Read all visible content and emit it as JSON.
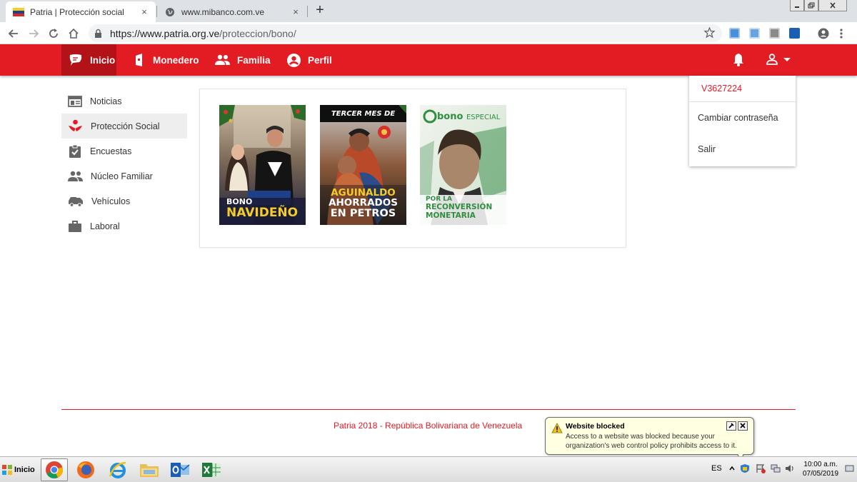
{
  "browser": {
    "tabs": [
      {
        "title": "Patria | Protección social",
        "active": true
      },
      {
        "title": "www.mibanco.com.ve",
        "active": false
      }
    ],
    "new_tab_label": "+",
    "close_glyph": "×",
    "url_host": "https://www.patria.org.ve",
    "url_path": "/proteccion/bono/"
  },
  "appbar": {
    "nav": [
      {
        "label": "Inicio",
        "icon": "chat-bubble-icon",
        "active": true
      },
      {
        "label": "Monedero",
        "icon": "wallet-icon",
        "active": false
      },
      {
        "label": "Familia",
        "icon": "people-icon",
        "active": false
      },
      {
        "label": "Perfil",
        "icon": "account-circle-icon",
        "active": false
      }
    ],
    "accent_color": "#e31b23"
  },
  "user_menu": {
    "user_id": "V3627224",
    "items": [
      "Cambiar contraseña",
      "Salir"
    ]
  },
  "sidebar": {
    "items": [
      {
        "label": "Noticias",
        "icon": "newspaper-icon",
        "active": false
      },
      {
        "label": "Protección Social",
        "icon": "care-hands-icon",
        "active": true
      },
      {
        "label": "Encuestas",
        "icon": "clipboard-check-icon",
        "active": false
      },
      {
        "label": "Núcleo Familiar",
        "icon": "family-icon",
        "active": false
      },
      {
        "label": "Vehículos",
        "icon": "vehicle-icon",
        "active": false
      },
      {
        "label": "Laboral",
        "icon": "briefcase-icon",
        "active": false
      }
    ]
  },
  "bonos": [
    {
      "line1": "BONO",
      "line2": "NAVIDEÑO"
    },
    {
      "top": "TERCER MES DE",
      "line1": "AGUINALDO",
      "line2": "AHORRADOS",
      "line3": "EN PETROS"
    },
    {
      "brand": "bono",
      "brand2": "ESPECIAL",
      "line1": "POR LA",
      "line2": "RECONVERSIÓN",
      "line3": "MONETARIA"
    }
  ],
  "footer": {
    "text": "Patria 2018 - República Bolivariana de Venezuela"
  },
  "notification": {
    "title": "Website blocked",
    "body": "Access to a website was blocked because your organization's web control policy prohibits access to it."
  },
  "taskbar": {
    "start_label": "Inicio",
    "language": "ES",
    "time": "10:00 a.m.",
    "date": "07/05/2019"
  }
}
